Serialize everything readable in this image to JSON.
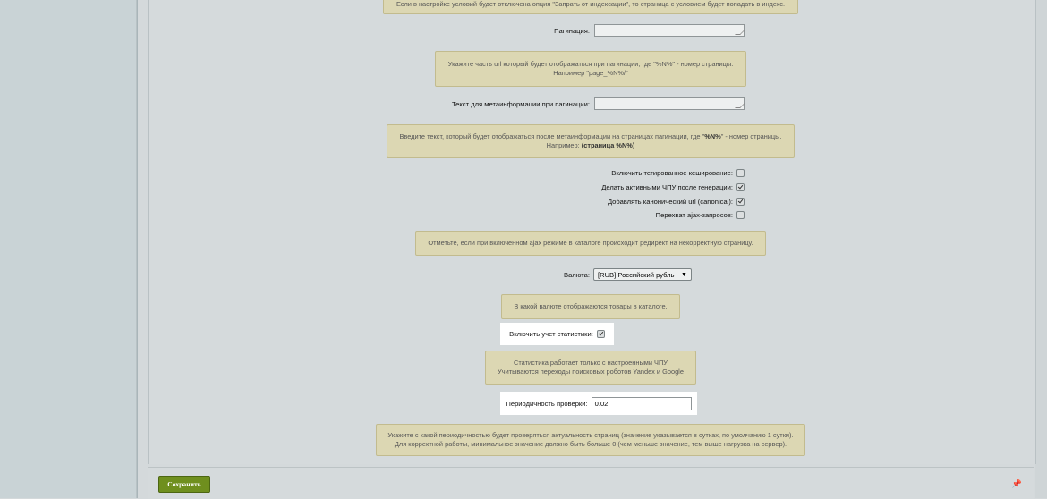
{
  "top_note": "Если в настройке условий будет отключена опция \"Запрать от индексации\", то страница с условием будет попадать в индекс.",
  "pagination": {
    "label": "Пагинация:",
    "value": "",
    "note_line1": "Укажите часть url который будет отображаться при пагинации, где \"%N%\" - номер страницы.",
    "note_line2": "Например \"page_%N%/\""
  },
  "meta_text": {
    "label": "Текст для метаинформации при пагинации:",
    "value": "",
    "note_line1_a": "Введите текст, который будет отображаться после метаинформации на страницах пагинации, где \"",
    "note_line1_b": "%N%",
    "note_line1_c": "\" - номер страницы.",
    "note_line2_a": "Например: ",
    "note_line2_b": "(страница %N%)"
  },
  "checkboxes": [
    {
      "label": "Включить тегированное кеширование:",
      "checked": false
    },
    {
      "label": "Делать активными ЧПУ после генерации:",
      "checked": true
    },
    {
      "label": "Добавлять канонический url (canonical):",
      "checked": true
    },
    {
      "label": "Перехват ajax-запросов:",
      "checked": false
    }
  ],
  "ajax_note": "Отметьте, если при включенном ajax режиме в каталоге происходит редирект на некорректную страницу.",
  "currency": {
    "label": "Валюта:",
    "selected": "[RUB] Российский рубль",
    "note": "В какой валюте отображаются товары в каталоге."
  },
  "stats": {
    "label": "Включить учет статистики:",
    "checked": true,
    "note_line1": "Статистика работает только с настроенными ЧПУ",
    "note_line2": "Учитываются переходы поисковых роботов Yandex и Google"
  },
  "period": {
    "label": "Периодичность проверки:",
    "value": "0.02",
    "note_line1": "Укажите с какой периодичностью будет проверяться актуальность страниц (значение указывается в сутках, по умолчанию 1 сутки).",
    "note_line2": "Для корректной работы, минимальное значение должно быть больше 0 (чем меньше значение, тем выше нагрузка на сервер)."
  },
  "footer": {
    "save_label": "Сохранить",
    "pin_icon": "pin-icon"
  }
}
